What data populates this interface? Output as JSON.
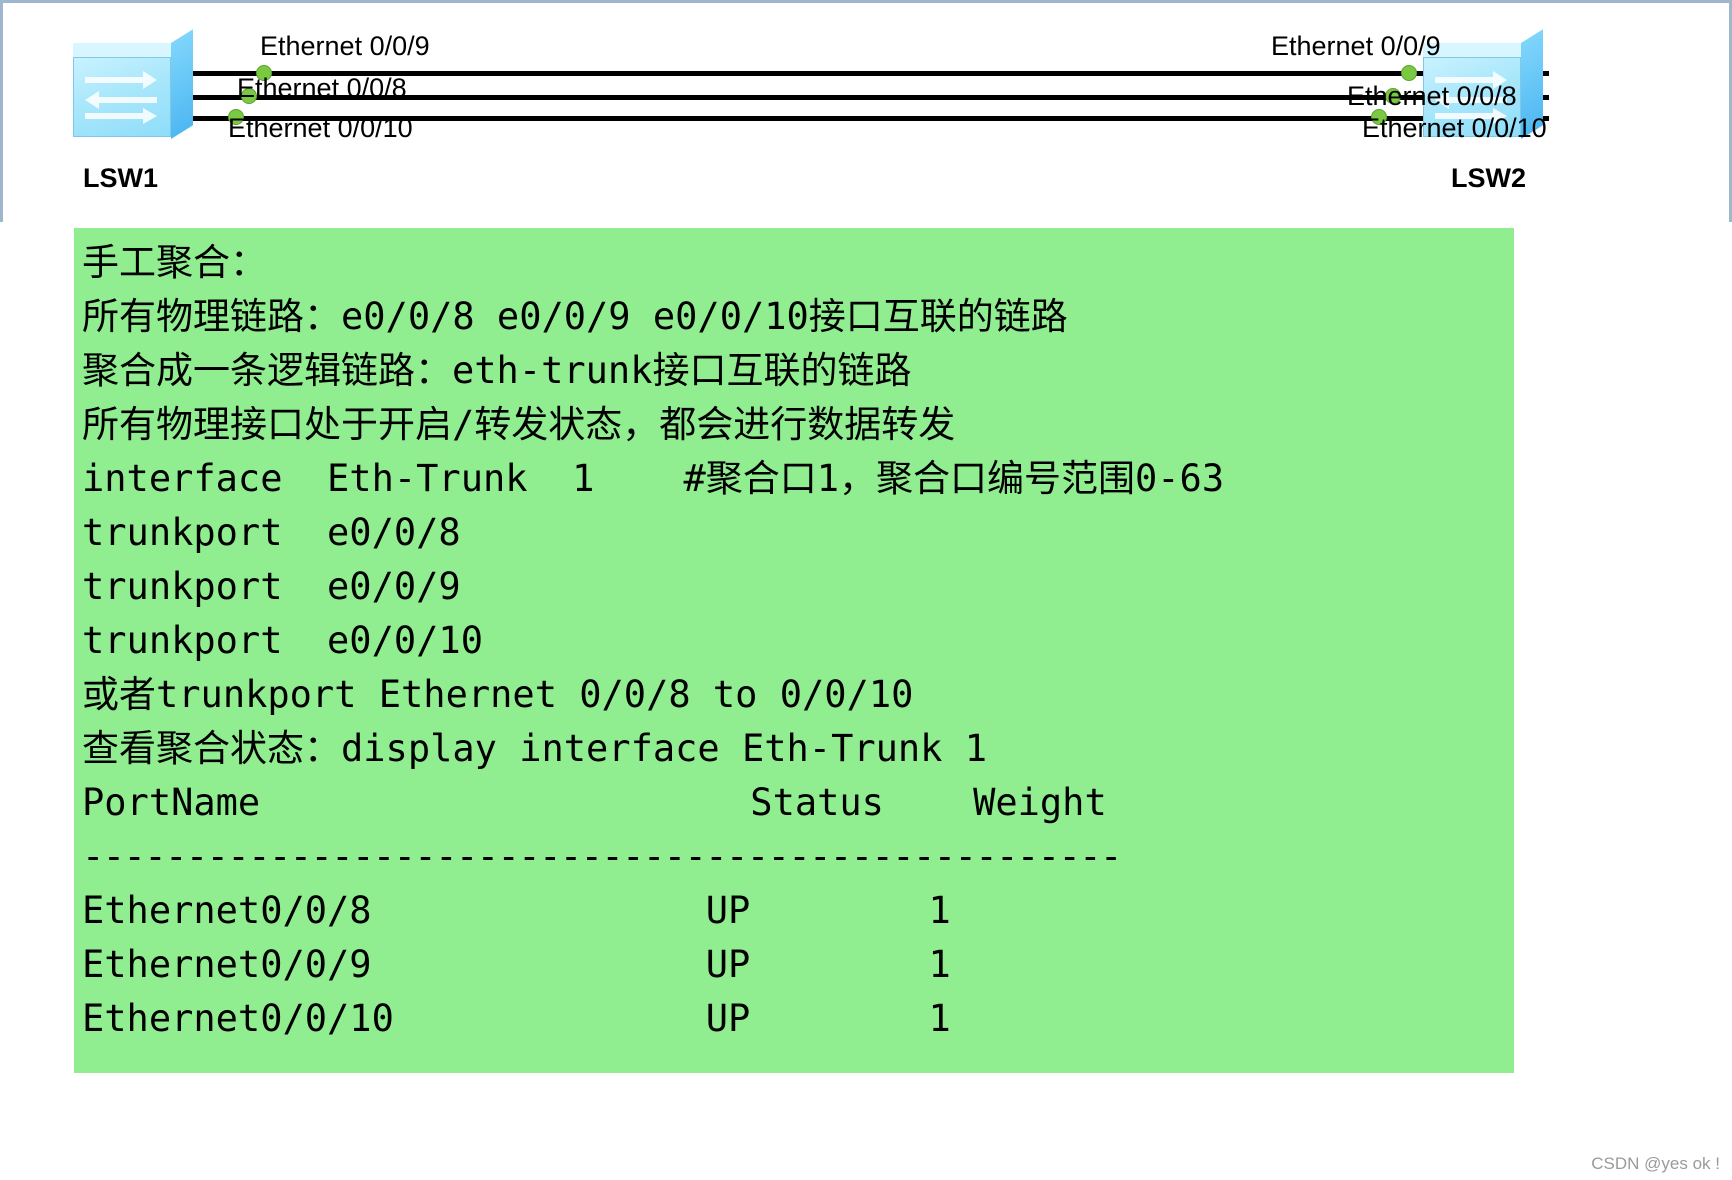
{
  "topology": {
    "left_device": {
      "name": "LSW1"
    },
    "right_device": {
      "name": "LSW2"
    },
    "links": [
      {
        "left_label": "Ethernet 0/0/9",
        "right_label": "Ethernet 0/0/9"
      },
      {
        "left_label": "Ethernet 0/0/8",
        "right_label": "Ethernet 0/0/8"
      },
      {
        "left_label": "Ethernet 0/0/10",
        "right_label": "Ethernet 0/0/10"
      }
    ]
  },
  "note": {
    "background_color": "#90ee90",
    "lines": [
      "手工聚合：",
      "所有物理链路：e0/0/8 e0/0/9 e0/0/10接口互联的链路",
      "聚合成一条逻辑链路：eth-trunk接口互联的链路",
      "所有物理接口处于开启/转发状态，都会进行数据转发",
      "interface  Eth-Trunk  1    #聚合口1，聚合口编号范围0-63",
      "trunkport  e0/0/8",
      "trunkport  e0/0/9",
      "trunkport  e0/0/10",
      "或者trunkport Ethernet 0/0/8 to 0/0/10",
      "查看聚合状态：display interface Eth-Trunk 1"
    ],
    "table": {
      "headers": [
        "PortName",
        "Status",
        "Weight"
      ],
      "separator": "--------------------------------------------------",
      "rows": [
        {
          "port": "Ethernet0/0/8",
          "status": "UP",
          "weight": "1"
        },
        {
          "port": "Ethernet0/0/9",
          "status": "UP",
          "weight": "1"
        },
        {
          "port": "Ethernet0/0/10",
          "status": "UP",
          "weight": "1"
        }
      ]
    }
  },
  "watermark": "CSDN @yes ok !"
}
